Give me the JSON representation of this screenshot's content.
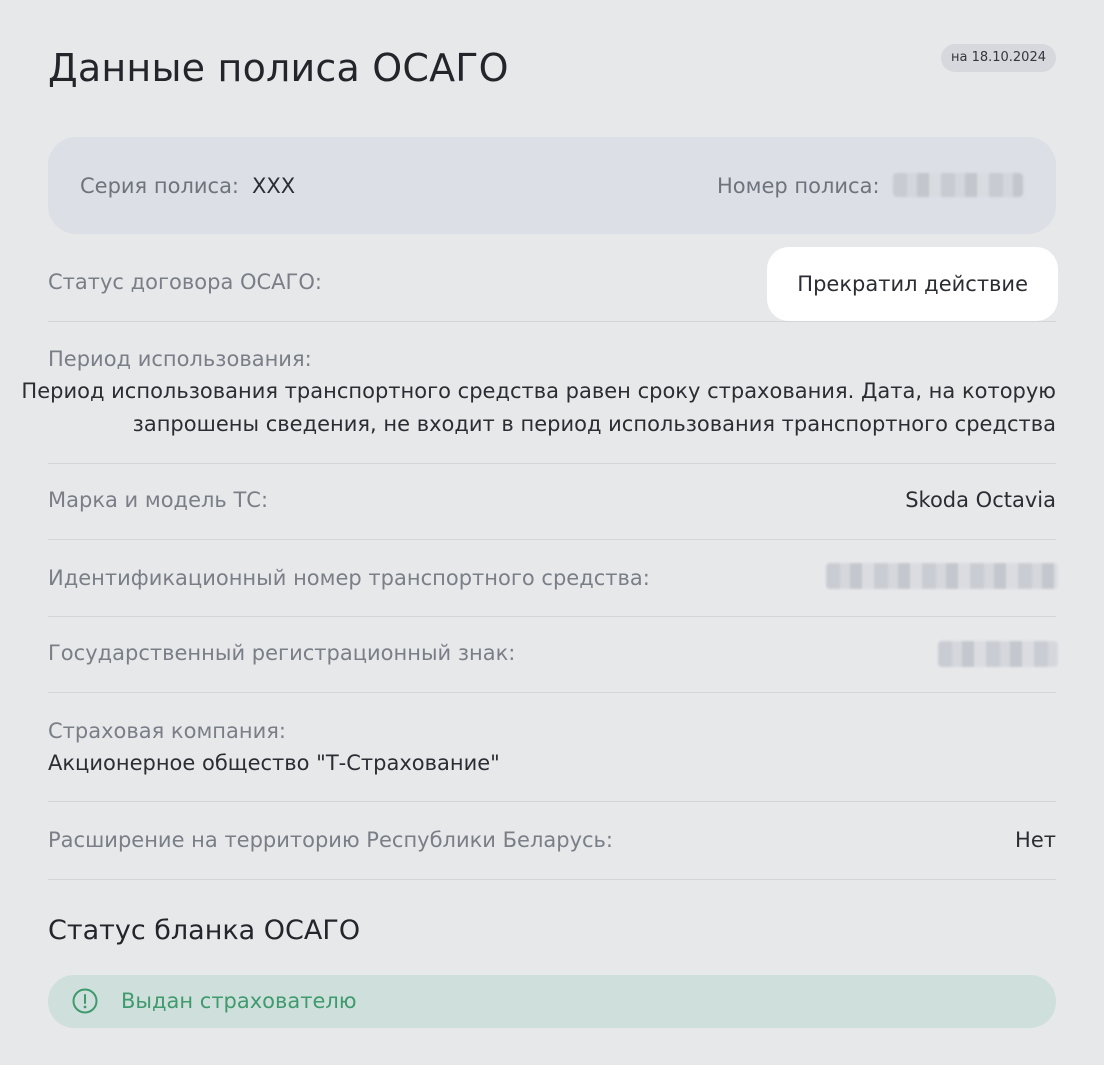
{
  "header": {
    "title": "Данные полиса ОСАГО",
    "date_badge": "на 18.10.2024"
  },
  "policy": {
    "series_label": "Серия полиса:",
    "series_value": "XXX",
    "number_label": "Номер полиса:"
  },
  "contract_status": {
    "label": "Статус договора ОСАГО:",
    "value": "Прекратил действие"
  },
  "usage_period": {
    "label": "Период использования:",
    "line1": "Период использования транспортного средства равен сроку страхования. Дата, на которую",
    "line2": "запрошены сведения, не входит в период использования транспортного средства"
  },
  "vehicle": {
    "model_label": "Марка и модель ТС:",
    "model_value": "Skoda Octavia",
    "vin_label": "Идентификационный номер транспортного средства:",
    "plate_label": "Государственный регистрационный знак:"
  },
  "insurer": {
    "label": "Страховая компания:",
    "value": "Акционерное общество \"Т-Страхование\""
  },
  "belarus": {
    "label": "Расширение на территорию Республики Беларусь:",
    "value": "Нет"
  },
  "blank_status": {
    "title": "Статус бланка ОСАГО",
    "value": "Выдан страхователю",
    "icon": "exclamation-circle-icon",
    "color": "#3f9a6e"
  },
  "colors": {
    "background": "#e7e8ea",
    "card": "#dcdfe6",
    "pill": "#ffffff",
    "success_bg": "#cfe0dc"
  }
}
